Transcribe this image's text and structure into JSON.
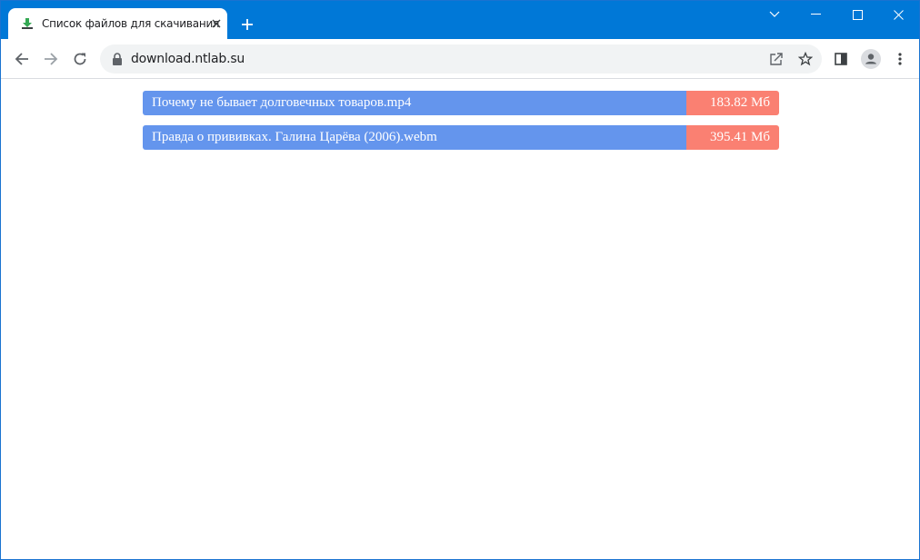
{
  "browser": {
    "tab": {
      "title": "Список файлов для скачивания",
      "favicon": "download-icon"
    },
    "address_bar": {
      "url": "download.ntlab.su"
    },
    "colors": {
      "titlebar": "#0078d7",
      "filename_bg": "#6495ed",
      "filesize_bg": "#fa8072"
    }
  },
  "files": [
    {
      "name": "Почему не бывает долговечных товаров.mp4",
      "size": "183.82 Мб"
    },
    {
      "name": "Правда о прививках. Галина Царёва (2006).webm",
      "size": "395.41 Мб"
    }
  ]
}
